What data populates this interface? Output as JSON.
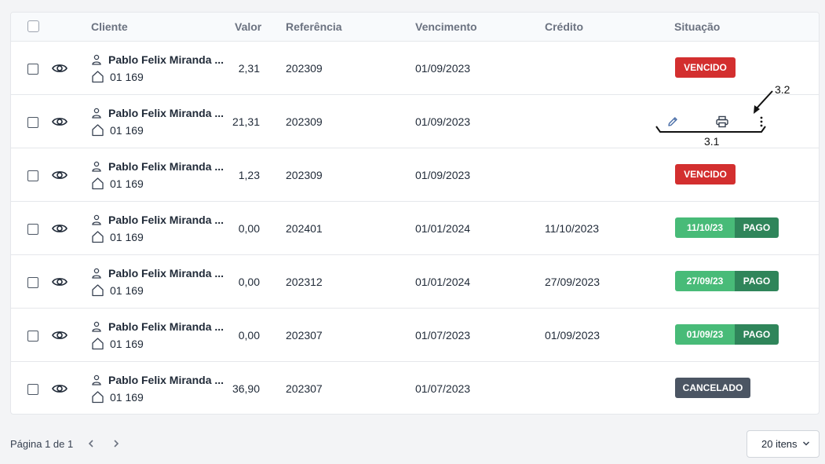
{
  "table": {
    "headers": {
      "cliente": "Cliente",
      "valor": "Valor",
      "referencia": "Referência",
      "vencimento": "Vencimento",
      "credito": "Crédito",
      "situacao": "Situação"
    },
    "rows": [
      {
        "cliente": "Pablo Felix Miranda ...",
        "codigo": "01 169",
        "valor": "2,31",
        "referencia": "202309",
        "vencimento": "01/09/2023",
        "credito": "",
        "status": "VENCIDO",
        "status_date": ""
      },
      {
        "cliente": "Pablo Felix Miranda ...",
        "codigo": "01 169",
        "valor": "21,31",
        "referencia": "202309",
        "vencimento": "01/09/2023",
        "credito": "",
        "status": "",
        "status_date": ""
      },
      {
        "cliente": "Pablo Felix Miranda ...",
        "codigo": "01 169",
        "valor": "1,23",
        "referencia": "202309",
        "vencimento": "01/09/2023",
        "credito": "",
        "status": "VENCIDO",
        "status_date": ""
      },
      {
        "cliente": "Pablo Felix Miranda ...",
        "codigo": "01 169",
        "valor": "0,00",
        "referencia": "202401",
        "vencimento": "01/01/2024",
        "credito": "11/10/2023",
        "status": "PAGO",
        "status_date": "11/10/23"
      },
      {
        "cliente": "Pablo Felix Miranda ...",
        "codigo": "01 169",
        "valor": "0,00",
        "referencia": "202312",
        "vencimento": "01/01/2024",
        "credito": "27/09/2023",
        "status": "PAGO",
        "status_date": "27/09/23"
      },
      {
        "cliente": "Pablo Felix Miranda ...",
        "codigo": "01 169",
        "valor": "0,00",
        "referencia": "202307",
        "vencimento": "01/07/2023",
        "credito": "01/09/2023",
        "status": "PAGO",
        "status_date": "01/09/23"
      },
      {
        "cliente": "Pablo Felix Miranda ...",
        "codigo": "01 169",
        "valor": "36,90",
        "referencia": "202307",
        "vencimento": "01/07/2023",
        "credito": "",
        "status": "CANCELADO",
        "status_date": ""
      }
    ]
  },
  "row_actions": {
    "icons": [
      "pencil-icon",
      "printer-icon",
      "more-vertical-icon"
    ]
  },
  "annotations": {
    "label_3_1": "3.1",
    "label_3_2": "3.2"
  },
  "footer": {
    "page_label": "Página 1 de 1",
    "per_page": "20 itens"
  },
  "colors": {
    "vencido": "#d32f2f",
    "pago_date": "#48bb78",
    "pago": "#2f855a",
    "cancelado": "#4b5563"
  }
}
